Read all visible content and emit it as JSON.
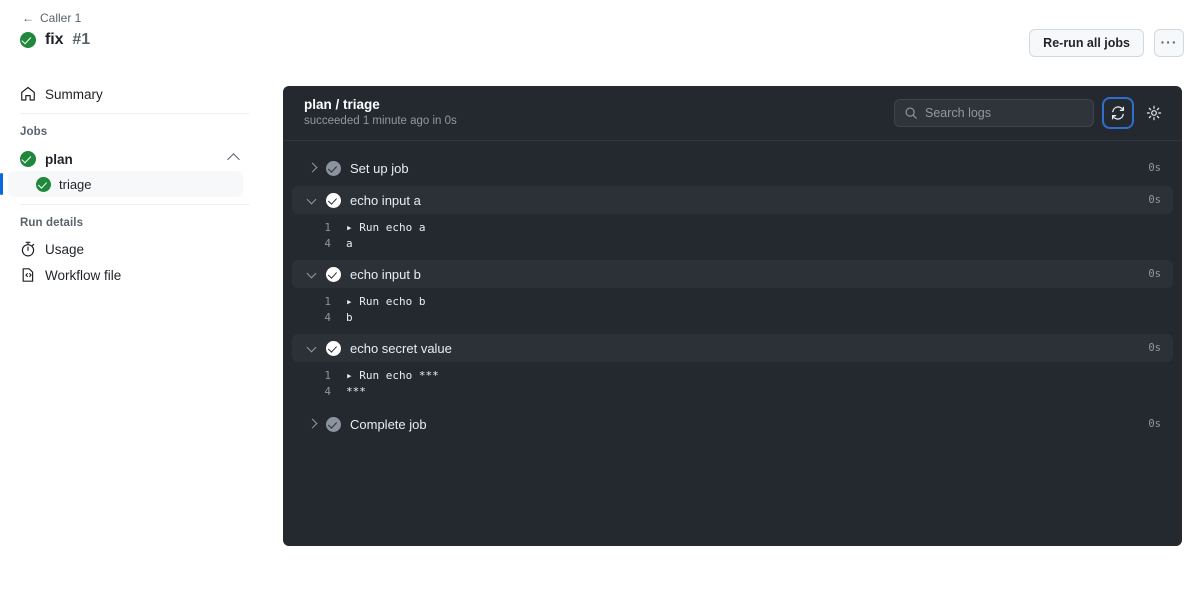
{
  "sidebar": {
    "back_label": "Caller 1",
    "back_icon": "arrow-left-icon",
    "run_name": "fix",
    "run_number": "#1",
    "run_status_icon": "check-circle-success-icon",
    "summary_label": "Summary",
    "summary_icon": "home-icon",
    "jobs_label": "Jobs",
    "job": {
      "name": "plan",
      "status_icon": "check-circle-success-icon",
      "collapse_icon": "chevron-up-icon",
      "steps": [
        {
          "name": "triage",
          "status_icon": "check-circle-success-icon",
          "selected": true
        }
      ]
    },
    "run_details_label": "Run details",
    "run_details_items": [
      {
        "label": "Usage",
        "icon": "stopwatch-icon"
      },
      {
        "label": "Workflow file",
        "icon": "workflow-file-icon"
      }
    ]
  },
  "header": {
    "rerun_label": "Re-run all jobs",
    "kebab_label": "···",
    "kebab_icon": "kebab-horizontal-icon"
  },
  "logs": {
    "title": "plan / triage",
    "subtitle": "succeeded 1 minute ago in 0s",
    "search_placeholder": "Search logs",
    "search_value": "",
    "search_icon": "search-icon",
    "refresh_icon": "refresh-icon",
    "settings_icon": "gear-icon",
    "groups": [
      {
        "title": "Set up job",
        "duration": "0s",
        "expanded": false,
        "status_icon": "check-circle-icon",
        "caret_icon": "chevron-right-icon",
        "lines": []
      },
      {
        "title": "echo input a",
        "duration": "0s",
        "expanded": true,
        "status_icon": "check-circle-icon",
        "caret_icon": "chevron-down-icon",
        "lines": [
          {
            "number": "1",
            "text": "▸ Run echo a"
          },
          {
            "number": "4",
            "text": "a"
          }
        ]
      },
      {
        "title": "echo input b",
        "duration": "0s",
        "expanded": true,
        "status_icon": "check-circle-icon",
        "caret_icon": "chevron-down-icon",
        "lines": [
          {
            "number": "1",
            "text": "▸ Run echo b"
          },
          {
            "number": "4",
            "text": "b"
          }
        ]
      },
      {
        "title": "echo secret value",
        "duration": "0s",
        "expanded": true,
        "status_icon": "check-circle-icon",
        "caret_icon": "chevron-down-icon",
        "lines": [
          {
            "number": "1",
            "text": "▸ Run echo ***"
          },
          {
            "number": "4",
            "text": "***"
          }
        ]
      },
      {
        "title": "Complete job",
        "duration": "0s",
        "expanded": false,
        "status_icon": "check-circle-icon",
        "caret_icon": "chevron-right-icon",
        "lines": []
      }
    ]
  },
  "colors": {
    "success_green": "#1f883d",
    "panel_bg": "#24292f",
    "row_open_bg": "#2c3138",
    "accent_blue": "#0969da",
    "focus_blue": "#316dca"
  }
}
